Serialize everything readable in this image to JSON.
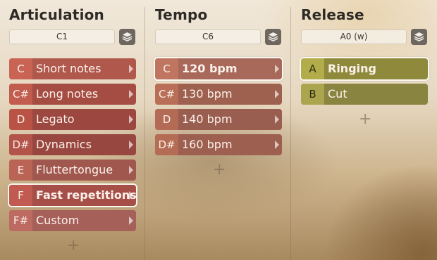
{
  "columns": [
    {
      "title": "Articulation",
      "preset": "C1",
      "add_label": "+",
      "rows": [
        {
          "key": "C",
          "label": "Short notes"
        },
        {
          "key": "C#",
          "label": "Long notes"
        },
        {
          "key": "D",
          "label": "Legato"
        },
        {
          "key": "D#",
          "label": "Dynamics"
        },
        {
          "key": "E",
          "label": "Fluttertongue"
        },
        {
          "key": "F",
          "label": "Fast repetitions"
        },
        {
          "key": "F#",
          "label": "Custom"
        }
      ]
    },
    {
      "title": "Tempo",
      "preset": "C6",
      "add_label": "+",
      "rows": [
        {
          "key": "C",
          "label": "120 bpm"
        },
        {
          "key": "C#",
          "label": "130 bpm"
        },
        {
          "key": "D",
          "label": "140 bpm"
        },
        {
          "key": "D#",
          "label": "160 bpm"
        }
      ]
    },
    {
      "title": "Release",
      "preset": "A0 (w)",
      "add_label": "+",
      "rows": [
        {
          "key": "A",
          "label": "Ringing"
        },
        {
          "key": "B",
          "label": "Cut"
        }
      ]
    }
  ],
  "icons": {
    "stack": "layers-icon",
    "chevron": "chevron-right-icon",
    "add": "plus-icon"
  }
}
